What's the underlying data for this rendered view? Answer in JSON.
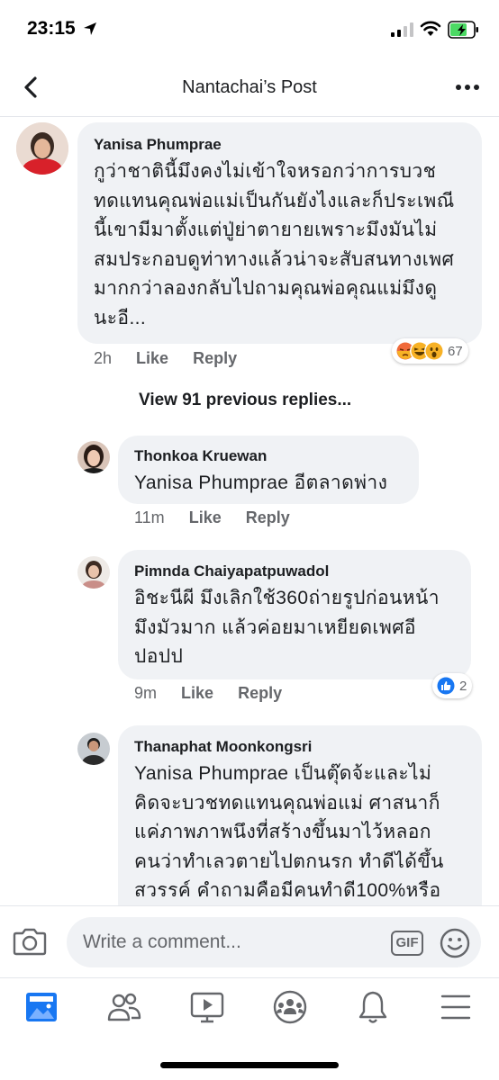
{
  "status_bar": {
    "time": "23:15"
  },
  "header": {
    "title": "Nantachai’s Post"
  },
  "comments": [
    {
      "author": "Yanisa Phumprae",
      "text": "กูว่าชาตินี้มึงคงไม่เข้าใจหรอกว่าการบวช\nทดแทนคุณพ่อแม่เป็นกันยังไงและก็ประเพณี\nนี้เขามีมาตั้งแต่ปู่ย่าตายายเพราะมึงมันไม่\nสมประกอบดูท่าทางแล้วน่าจะสับสนทางเพศ\nมากกว่าลองกลับไปถามคุณพ่อคุณแม่มึงดู\nนะอี...",
      "time": "2h",
      "like": "Like",
      "reply": "Reply",
      "reaction_count": "67",
      "reactions": [
        "angry",
        "haha",
        "wow"
      ]
    }
  ],
  "view_previous": "View 91 previous replies...",
  "replies": [
    {
      "author": "Thonkoa Kruewan",
      "text": "Yanisa Phumprae อีตลาดพ่าง",
      "time": "11m",
      "like": "Like",
      "reply": "Reply"
    },
    {
      "author": "Pimnda Chaiyapatpuwadol",
      "text": "อิชะนีผี มึงเลิกใช้360ถ่ายรูปก่อนหน้า\nมึงมัวมาก แล้วค่อยมาเหยียดเพศอี\nปอปป",
      "time": "9m",
      "like": "Like",
      "reply": "Reply",
      "reaction_count": "2",
      "reactions": [
        "like"
      ]
    },
    {
      "author": "Thanaphat Moonkongsri",
      "text": "Yanisa Phumprae เป็นตุ๊ดจ้ะและไม่\nคิดจะบวชทดแทนคุณพ่อแม่ ศาสนาก็\nแค่ภาพภาพนึงที่สร้างขึ้นมาไว้หลอก\nคนว่าทำเลวตายไปตกนรก ทำดีได้ขึ้น\nสวรรค์ คำถามคือมีคนทำดี100%หรือ"
    }
  ],
  "composer": {
    "placeholder": "Write a comment...",
    "gif_label": "GIF"
  },
  "tabbar": [
    "news-feed-icon",
    "friends-icon",
    "watch-icon",
    "groups-icon",
    "notifications-icon",
    "menu-icon"
  ],
  "colors": {
    "accent": "#1877f2",
    "bubble": "#f0f2f5",
    "secondary_text": "#65676b"
  }
}
